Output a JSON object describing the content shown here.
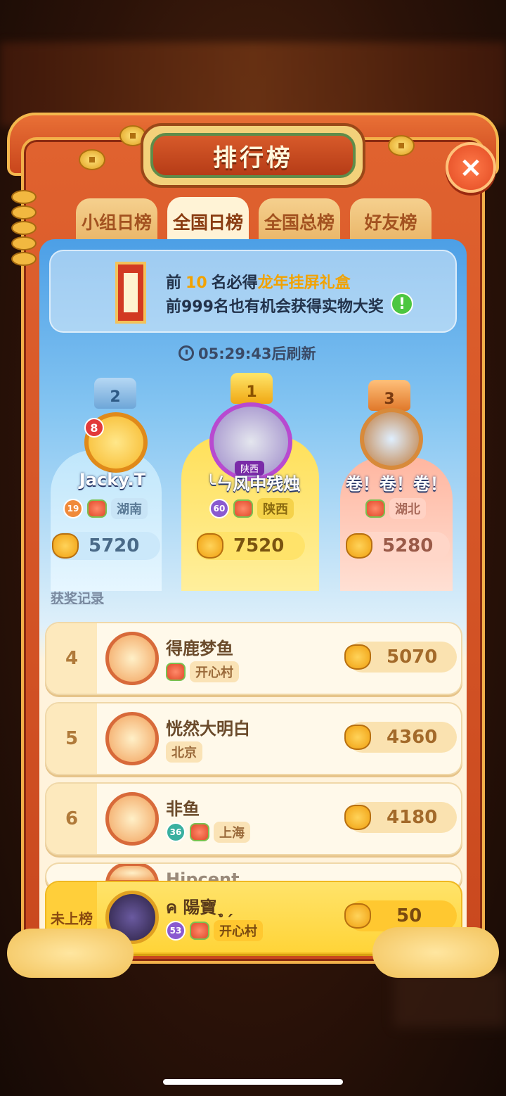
{
  "header": {
    "title": "排行榜",
    "close_icon": "×"
  },
  "tabs": [
    {
      "label": "小组日榜",
      "active": false
    },
    {
      "label": "全国日榜",
      "active": true
    },
    {
      "label": "全国总榜",
      "active": false
    },
    {
      "label": "好友榜",
      "active": false
    }
  ],
  "banner": {
    "line1_prefix": "前",
    "line1_num": "10",
    "line1_mid": "名必得",
    "line1_prize": "龙年挂屏礼盒",
    "line2": "前999名也有机会获得实物大奖",
    "info_icon": "!"
  },
  "refresh": {
    "text": "05:29:43后刷新"
  },
  "podium": [
    {
      "rank": "2",
      "name": "Jacky.T",
      "level": "19",
      "region": "湖南",
      "score": "5720",
      "avatar_badge": "8"
    },
    {
      "rank": "1",
      "name": "╰ㄣ风中残烛",
      "level": "60",
      "region": "陕西",
      "score": "7520",
      "region_tag": "陕西"
    },
    {
      "rank": "3",
      "name": "卷！卷！卷！",
      "level": "",
      "region": "湖北",
      "score": "5280"
    }
  ],
  "award_link": "获奖记录",
  "rows": [
    {
      "rank": "4",
      "name": "得鹿梦鱼",
      "level": "",
      "region": "开心村",
      "score": "5070"
    },
    {
      "rank": "5",
      "name": "恍然大明白",
      "level": "",
      "region": "北京",
      "score": "4360"
    },
    {
      "rank": "6",
      "name": "非鱼",
      "level": "36",
      "region": "上海",
      "score": "4180"
    }
  ],
  "partial_row_name": "Hipcent",
  "me": {
    "rank": "未上榜",
    "name": "ค 陽寶ˎ̥ˏ",
    "level": "53",
    "region": "开心村",
    "score": "50"
  },
  "colors": {
    "frame": "#d8542a",
    "gold": "#f2b840",
    "panel_sky": "#4c9fe6",
    "cream": "#fff9ea"
  }
}
